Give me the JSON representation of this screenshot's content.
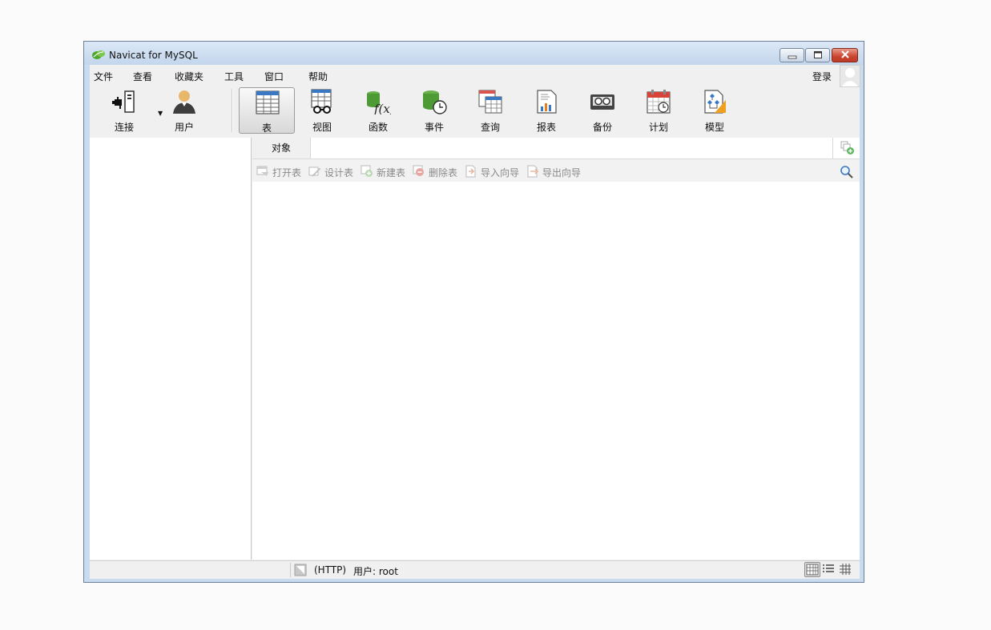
{
  "window": {
    "title": "Navicat for MySQL"
  },
  "menu": [
    "文件",
    "查看",
    "收藏夹",
    "工具",
    "窗口",
    "帮助"
  ],
  "account": {
    "login_label": "登录"
  },
  "toolbar": {
    "connect": "连接",
    "user": "用户",
    "items": [
      "表",
      "视图",
      "函数",
      "事件",
      "查询",
      "报表",
      "备份",
      "计划",
      "模型"
    ],
    "active": "表"
  },
  "tabs": {
    "object": "对象"
  },
  "object_toolbar": [
    "打开表",
    "设计表",
    "新建表",
    "删除表",
    "导入向导",
    "导出向导"
  ],
  "status": {
    "protocol": "(HTTP)",
    "user": "用户: root"
  },
  "colors": {
    "accent": "#3b78c4",
    "disabled_text": "#8a8a8a"
  }
}
